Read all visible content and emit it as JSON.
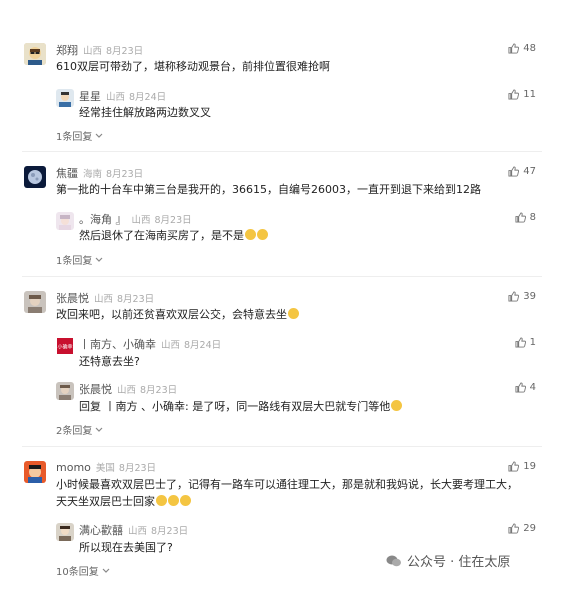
{
  "threads": [
    {
      "comment": {
        "name": "郑翔",
        "location": "山西",
        "date": "8月23日",
        "likes": "48",
        "text": [
          "610双层可带劲了，堪称移动观景台，前排位置很难抢啊"
        ]
      },
      "replies": [
        {
          "name": "星星",
          "location": "山西",
          "date": "8月24日",
          "likes": "11",
          "text": [
            "经常挂住解放路两边数叉叉"
          ]
        }
      ],
      "more": "1条回复"
    },
    {
      "comment": {
        "name": "焦疆",
        "location": "海南",
        "date": "8月23日",
        "likes": "47",
        "text": [
          "第一批的十台车中第三台是我开的，36615，自编号26003，一直开到退下来给到12路"
        ]
      },
      "replies": [
        {
          "name": "。海角 』",
          "location": "山西",
          "date": "8月23日",
          "likes": "8",
          "text": [
            "然后退休了在海南买房了，是不是"
          ]
        }
      ],
      "more": "1条回复"
    },
    {
      "comment": {
        "name": "张晨悦",
        "location": "山西",
        "date": "8月23日",
        "likes": "39",
        "text": [
          "改回来吧，以前还贫喜欢双层公交，会特意去坐"
        ]
      },
      "replies": [
        {
          "name": "丨南方、小确幸",
          "location": "山西",
          "date": "8月24日",
          "likes": "1",
          "text": [
            "还特意去坐?"
          ]
        },
        {
          "name": "张晨悦",
          "location": "山西",
          "date": "8月23日",
          "likes": "4",
          "text": [
            "回复 丨南方 、小确幸: 是了呀，同一路线有双层大巴就专门等他"
          ]
        }
      ],
      "more": "2条回复"
    },
    {
      "comment": {
        "name": "momo",
        "location": "美国",
        "date": "8月23日",
        "likes": "19",
        "text": [
          "小时候最喜欢双层巴士了，记得有一路车可以通往理工大，那是就和我妈说，长大要考理工大，",
          "天天坐双层巴士回家"
        ]
      },
      "replies": [
        {
          "name": "满心歡囍",
          "location": "山西",
          "date": "8月23日",
          "likes": "29",
          "text": [
            "所以现在去美国了?"
          ]
        }
      ],
      "more": "10条回复"
    }
  ],
  "watermark": "公众号 · 住在太原"
}
